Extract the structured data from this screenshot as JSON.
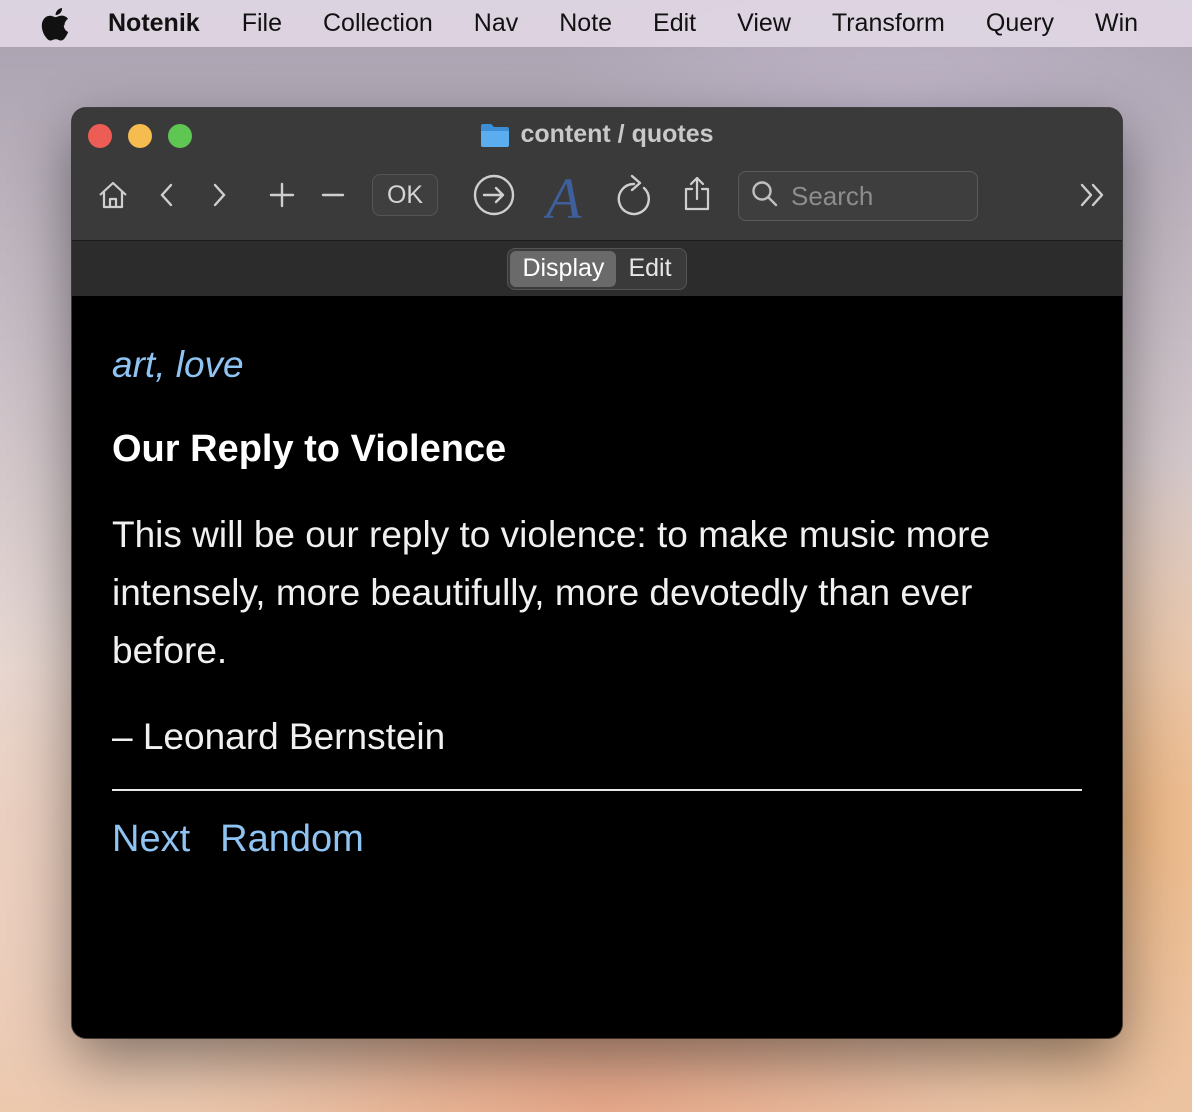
{
  "menubar": {
    "app_name": "Notenik",
    "items": [
      "File",
      "Collection",
      "Nav",
      "Note",
      "Edit",
      "View",
      "Transform",
      "Query",
      "Win"
    ]
  },
  "window": {
    "title": "content / quotes"
  },
  "toolbar": {
    "ok_label": "OK",
    "search_placeholder": "Search",
    "icons": [
      "home-icon",
      "chevron-left-icon",
      "chevron-right-icon",
      "plus-icon",
      "minus-icon",
      "go-arrow-icon",
      "font-icon",
      "reload-icon",
      "share-icon",
      "search-icon",
      "overflow-chevrons-icon"
    ]
  },
  "segmented": {
    "display_label": "Display",
    "edit_label": "Edit",
    "selected": "Display"
  },
  "note": {
    "tags": {
      "first": "art",
      "separator": ", ",
      "second": "love"
    },
    "title": "Our Reply to Violence",
    "body": "This will be our reply to violence: to make music more intensely, more beautifully, more devotedly than ever before.",
    "attribution": "– Leonard Bernstein",
    "nav_links": {
      "next": "Next",
      "random": "Random"
    }
  },
  "colors": {
    "link": "#8fc3f2",
    "titlebar": "#3a3a3a",
    "content_bg": "#000000",
    "traffic_close": "#ee5c56",
    "traffic_min": "#f5bd4f",
    "traffic_max": "#5fc553"
  }
}
